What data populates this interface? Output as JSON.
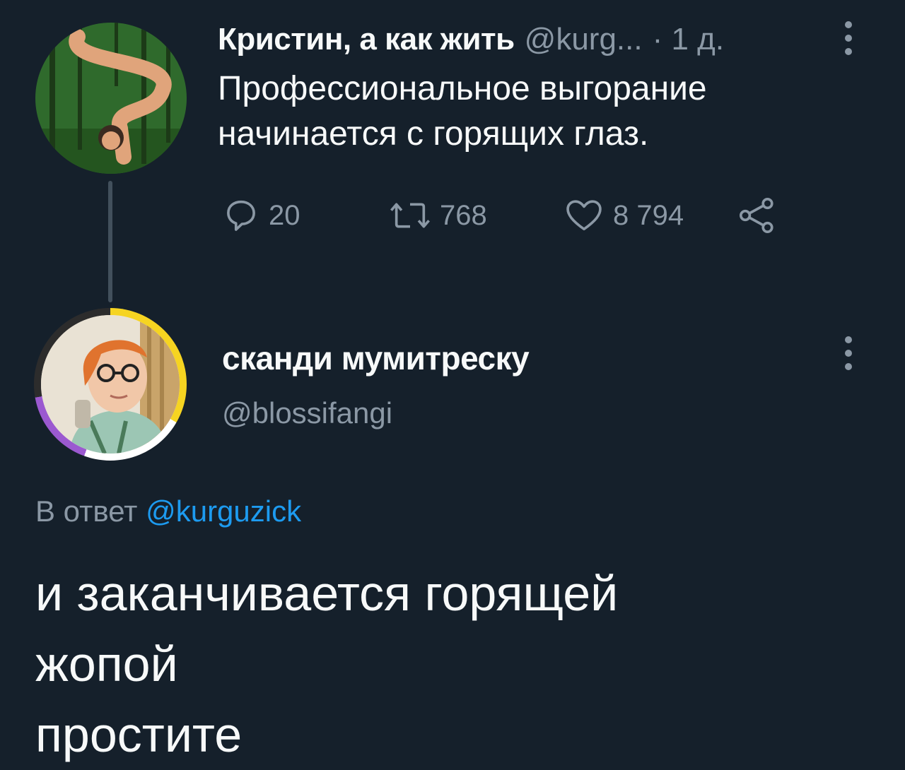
{
  "tweet1": {
    "display_name": "Кристин, а как жить",
    "handle": "@kurg...",
    "time": "· 1 д.",
    "text": "Профессиональное выгорание начинается с горящих глаз.",
    "actions": {
      "reply_count": "20",
      "retweet_count": "768",
      "like_count": "8 794"
    }
  },
  "tweet2": {
    "display_name": "сканди мумитреску",
    "handle": "@blossifangi",
    "reply_prefix": "В ответ",
    "reply_mention": "@kurguzick",
    "text_lines": [
      "и заканчивается горящей",
      "жопой",
      "простите"
    ]
  },
  "colors": {
    "background": "#15202b",
    "text_primary": "#f7f9f9",
    "text_secondary": "#8b98a5",
    "link": "#1d9bf0"
  },
  "icons": [
    "more-vertical-icon",
    "reply-icon",
    "retweet-icon",
    "like-icon",
    "share-icon"
  ]
}
